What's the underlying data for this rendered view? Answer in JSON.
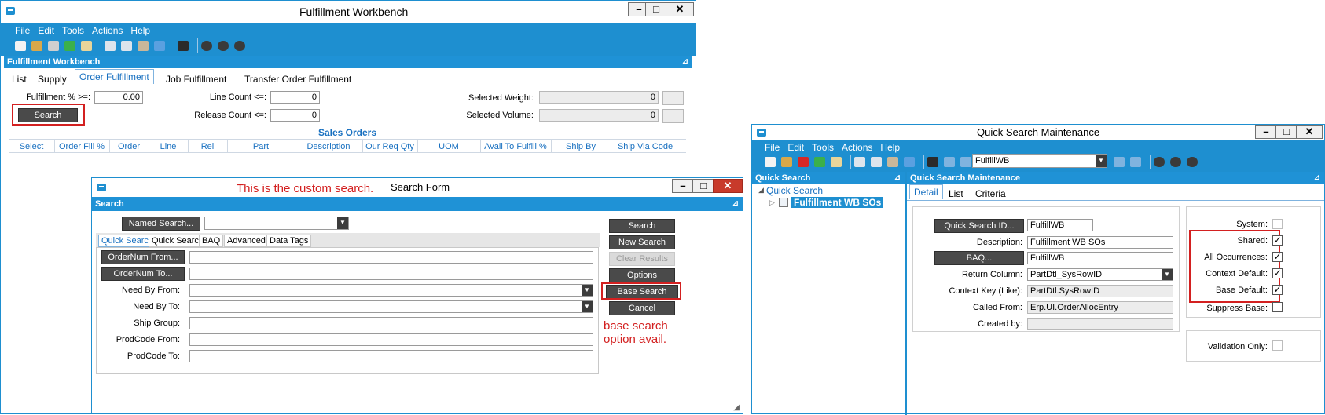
{
  "fw": {
    "title": "Fulfillment Workbench",
    "menu": [
      "File",
      "Edit",
      "Tools",
      "Actions",
      "Help"
    ],
    "panel_header": "Fulfillment Workbench",
    "tabs": [
      "List",
      "Supply",
      "Order Fulfillment",
      "Job Fulfillment",
      "Transfer Order Fulfillment"
    ],
    "fulfillment_label": "Fulfillment % >=:",
    "fulfillment_value": "0.00",
    "search_button": "Search",
    "line_count_label": "Line Count <=:",
    "line_count_value": "0",
    "release_count_label": "Release Count <=:",
    "release_count_value": "0",
    "selected_weight_label": "Selected Weight:",
    "selected_weight_value": "0",
    "selected_volume_label": "Selected Volume:",
    "selected_volume_value": "0",
    "grid_title": "Sales Orders",
    "columns": [
      "Select",
      "Order Fill %",
      "Order",
      "Line",
      "Rel",
      "Part",
      "Description",
      "Our Req Qty",
      "UOM",
      "Avail To Fulfill %",
      "Ship By",
      "Ship Via Code"
    ]
  },
  "sf": {
    "annotation": "This is the custom search.",
    "title": "Search Form",
    "panel_header": "Search",
    "named_search_button": "Named Search...",
    "tabs": [
      "Quick Search",
      "Quick Search",
      "BAQ",
      "Advanced",
      "Data Tags"
    ],
    "order_from_button": "OrderNum From...",
    "order_to_button": "OrderNum To...",
    "need_by_from_label": "Need By From:",
    "need_by_to_label": "Need By To:",
    "ship_group_label": "Ship Group:",
    "prodcode_from_label": "ProdCode From:",
    "prodcode_to_label": "ProdCode To:",
    "buttons": {
      "search": "Search",
      "new_search": "New Search",
      "clear_results": "Clear Results",
      "options": "Options",
      "base_search": "Base Search",
      "cancel": "Cancel"
    },
    "annotation2_line1": "base search",
    "annotation2_line2": "option avail."
  },
  "qsm": {
    "title": "Quick Search Maintenance",
    "menu": [
      "File",
      "Edit",
      "Tools",
      "Actions",
      "Help"
    ],
    "toolbar_combo": "FulfillWB",
    "left_header": "Quick Search",
    "tree_root": "Quick Search",
    "tree_child": "Fulfillment WB SOs",
    "right_header": "Quick Search Maintenance",
    "tabs": [
      "Detail",
      "List",
      "Criteria"
    ],
    "qs_id_button": "Quick Search ID...",
    "qs_id_value": "FulfillWB",
    "description_label": "Description:",
    "description_value": "Fulfillment WB SOs",
    "baq_button": "BAQ...",
    "baq_value": "FulfillWB",
    "return_column_label": "Return Column:",
    "return_column_value": "PartDtl_SysRowID",
    "context_key_label": "Context Key (Like):",
    "context_key_value": "PartDtl.SysRowID",
    "called_from_label": "Called From:",
    "called_from_value": "Erp.UI.OrderAllocEntry",
    "created_by_label": "Created by:",
    "created_by_value": "",
    "checks": {
      "system": "System:",
      "shared": "Shared:",
      "all_occurrences": "All Occurrences:",
      "context_default": "Context Default:",
      "base_default": "Base Default:",
      "suppress_base": "Suppress Base:",
      "validation_only": "Validation Only:"
    },
    "check_values": {
      "system": false,
      "shared": true,
      "all_occurrences": true,
      "context_default": true,
      "base_default": true,
      "suppress_base": false,
      "validation_only": false
    }
  },
  "colors": {
    "accent": "#1e8fd0",
    "annotation": "#d32020",
    "button_dark": "#4a4a4a"
  }
}
